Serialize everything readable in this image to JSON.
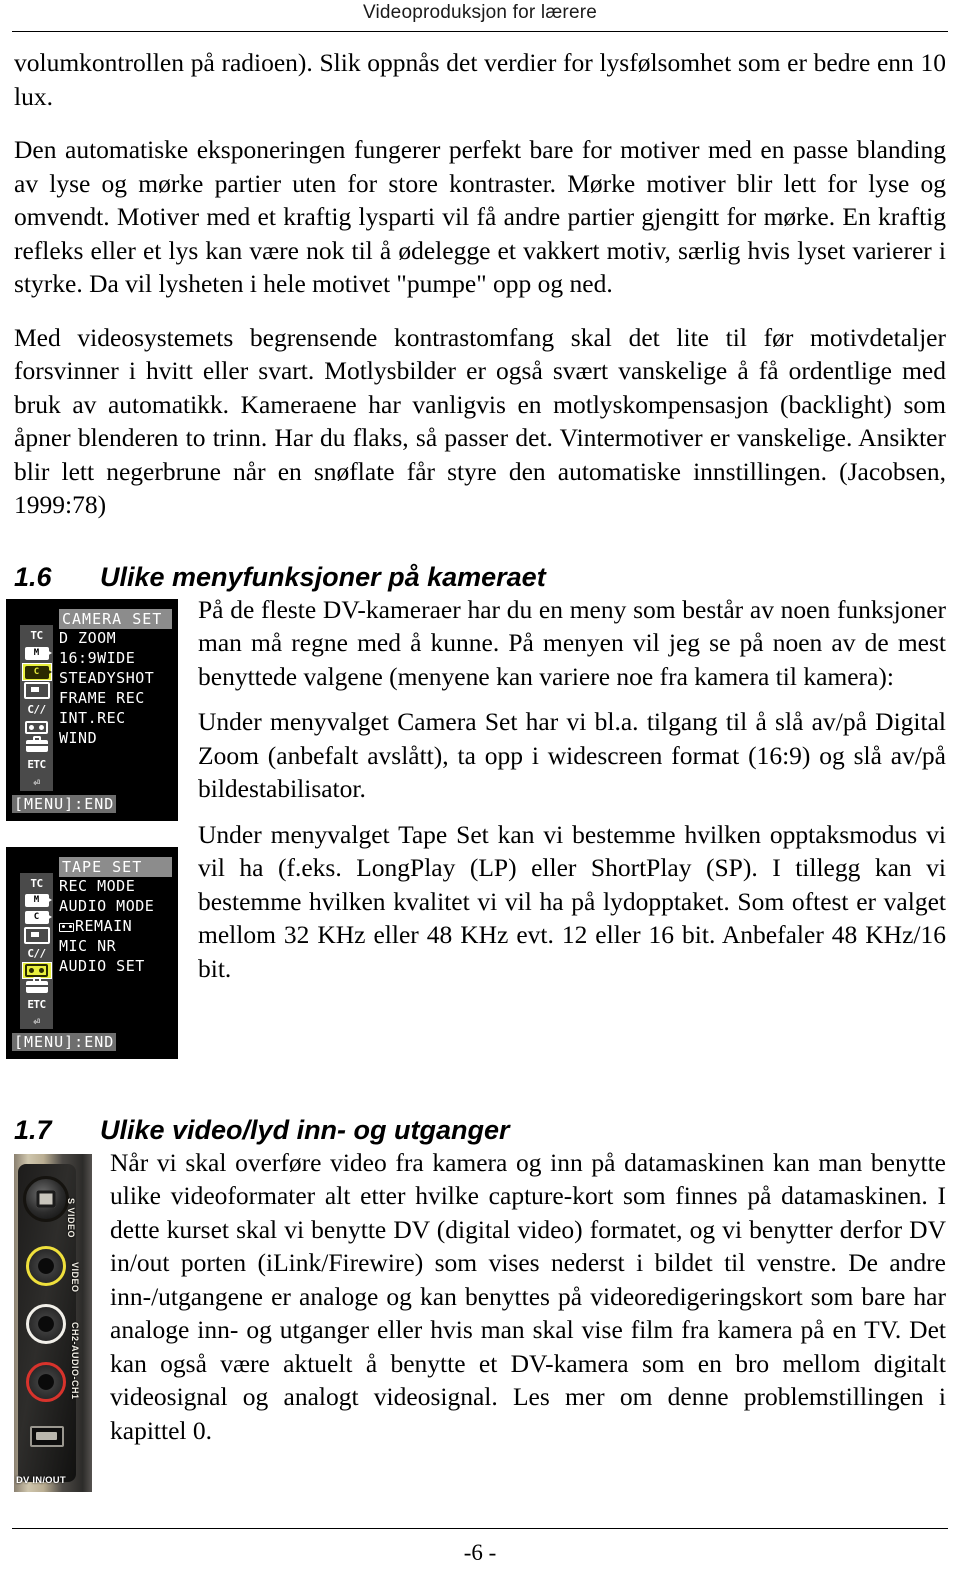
{
  "header": {
    "title": "Videoproduksjon for lærere"
  },
  "body": {
    "para_1": "volumkontrollen på radioen). Slik oppnås det verdier for lysfølsomhet som er bedre enn 10 lux.",
    "para_2": "Den automatiske eksponeringen fungerer perfekt bare for motiver med en passe blanding av lyse og mørke partier uten for store kontraster. Mørke motiver blir lett for lyse og omvendt. Motiver med et kraftig lysparti vil få andre partier gjengitt for mørke. En kraftig refleks eller et lys kan være nok til å ødelegge et vakkert motiv, særlig hvis lyset varierer i styrke. Da vil lysheten i hele motivet \"pumpe\" opp og ned.",
    "para_3": "Med videosystemets begrensende kontrastomfang skal det lite til før motivdetaljer forsvinner i hvitt eller svart. Motlysbilder er også svært vanskelige å få ordentlige med bruk av automatikk. Kameraene har vanligvis en motlyskompensasjon (backlight) som åpner blenderen to trinn. Har du flaks, så passer det. Vintermotiver er vanskelige. Ansikter blir lett negerbrune når en snøflate får styre den automatiske innstillingen. (Jacobsen, 1999:78)"
  },
  "section_16": {
    "number": "1.6",
    "title": "Ulike menyfunksjoner på kameraet",
    "para_1": "På de fleste DV-kameraer har du en meny som består av noen funksjoner man må regne med å kunne. På menyen vil jeg se på noen av de mest benyttede valgene (menyene kan variere noe fra kamera til kamera):",
    "para_2": "Under menyvalget Camera Set har vi bl.a. tilgang til å slå av/på Digital Zoom (anbefalt avslått), ta opp i widescreen format (16:9) og slå av/på bildestabilisator.",
    "para_3": "Under menyvalget Tape Set kan vi bestemme hvilken opptaksmodus vi vil ha (f.eks. LongPlay (LP) eller ShortPlay (SP). I tillegg kan vi bestemme hvilken kvalitet vi vil ha på lydopptaket. Som oftest er valget mellom 32 KHz eller 48 KHz evt. 12 eller 16 bit. Anbefaler 48 KHz/16 bit."
  },
  "figure_camera_set": {
    "title": "CAMERA SET",
    "items": [
      "D ZOOM",
      "16:9WIDE",
      "STEADYSHOT",
      "FRAME REC",
      "INT.REC",
      "WIND"
    ],
    "footer": "[MENU]:END",
    "icons": [
      {
        "name": "tc-icon",
        "label": "TC",
        "selected": false
      },
      {
        "name": "manual-camcorder-icon",
        "label": "M",
        "selected": false
      },
      {
        "name": "camera-set-icon",
        "label": "C",
        "selected": true
      },
      {
        "name": "vcr-set-icon",
        "label": "",
        "selected": false
      },
      {
        "name": "lcd-set-icon",
        "label": "C//",
        "selected": false
      },
      {
        "name": "tape-set-icon",
        "label": "",
        "selected": false
      },
      {
        "name": "setup-menu-icon",
        "label": "",
        "selected": false
      },
      {
        "name": "etc-icon",
        "label": "ETC",
        "selected": false
      },
      {
        "name": "return-icon",
        "label": "⏎",
        "selected": false
      }
    ],
    "highlight_color": "#e8ef3c"
  },
  "figure_tape_set": {
    "title": "TAPE SET",
    "items": [
      "REC MODE",
      "AUDIO MODE",
      "REMAIN",
      "MIC NR",
      "AUDIO SET"
    ],
    "remain_has_cassette_icon": true,
    "footer": "[MENU]:END",
    "icons": [
      {
        "name": "tc-icon",
        "label": "TC",
        "selected": false
      },
      {
        "name": "manual-camcorder-icon",
        "label": "M",
        "selected": false
      },
      {
        "name": "camera-set-icon",
        "label": "C",
        "selected": false
      },
      {
        "name": "vcr-set-icon",
        "label": "",
        "selected": false
      },
      {
        "name": "lcd-set-icon",
        "label": "C//",
        "selected": false
      },
      {
        "name": "tape-set-icon",
        "label": "",
        "selected": true
      },
      {
        "name": "setup-menu-icon",
        "label": "",
        "selected": false
      },
      {
        "name": "etc-icon",
        "label": "ETC",
        "selected": false
      },
      {
        "name": "return-icon",
        "label": "⏎",
        "selected": false
      }
    ],
    "highlight_color": "#e8ef3c"
  },
  "section_17": {
    "number": "1.7",
    "title": "Ulike video/lyd inn- og utganger",
    "para_1": "Når vi skal overføre video fra kamera og inn på datamaskinen kan man benytte ulike videoformater alt etter hvilke capture-kort som finnes på datamaskinen. I dette kurset skal vi benytte DV (digital video) formatet, og vi benytter derfor DV in/out porten (iLink/Firewire) som vises nederst i bildet til venstre. De andre inn-/utgangene er analoge og kan benyttes på videoredigeringskort som bare har analoge inn- og utganger eller hvis man skal vise film fra kamera på en TV. Det kan også være aktuelt å benytte et DV-kamera som en bro mellom digitalt videosignal og analogt videosignal. Les mer om denne problemstillingen i kapittel 0."
  },
  "figure_connectors": {
    "dv_label": "DV IN/OUT",
    "svideo_label": "S VIDEO",
    "video_label": "VIDEO",
    "audio_label": "CH2-AUDIO-CH1",
    "jack_colors": {
      "video": "#efe03c",
      "audio_left": "#f2f0ea",
      "audio_right": "#d8332c"
    }
  },
  "footer": {
    "page_number": "-6 -"
  }
}
